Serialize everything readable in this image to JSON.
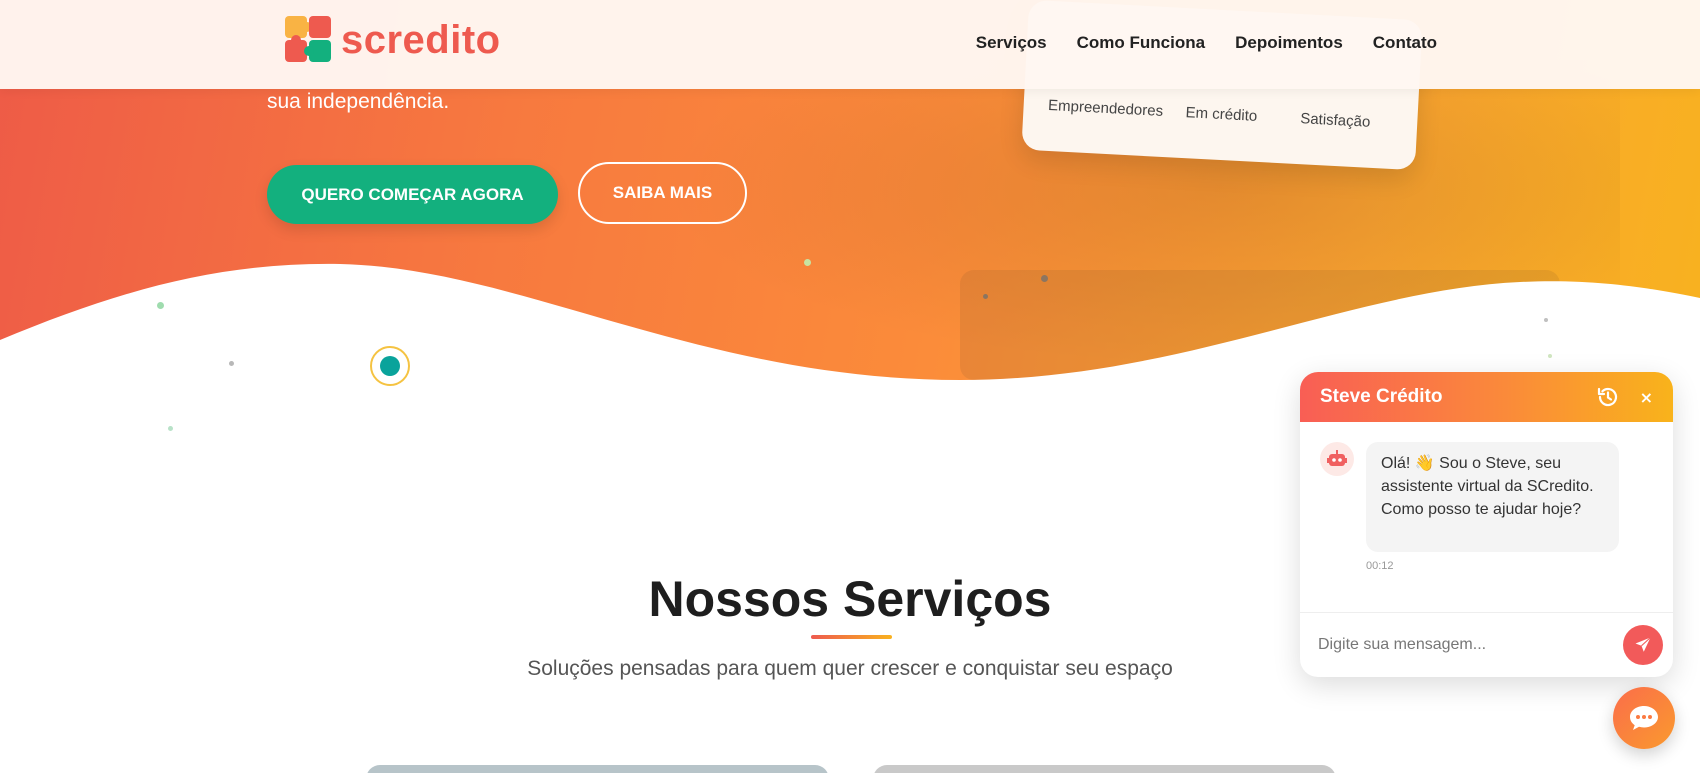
{
  "header": {
    "logo_text": "scredito",
    "nav": [
      "Serviços",
      "Como Funciona",
      "Depoimentos",
      "Contato"
    ]
  },
  "hero": {
    "subtitle_tail": "sua independência.",
    "cta_primary": "QUERO COMEÇAR AGORA",
    "cta_secondary": "SAIBA MAIS",
    "stats": [
      {
        "label": "Empreendedores"
      },
      {
        "label": "Em crédito"
      },
      {
        "label": "Satisfação"
      }
    ]
  },
  "services": {
    "title": "Nossos Serviços",
    "subtitle": "Soluções pensadas para quem quer crescer e conquistar seu espaço"
  },
  "chat": {
    "title": "Steve Crédito",
    "close_label": "×",
    "message": "Olá! 👋 Sou o Steve, seu assistente virtual da SCredito. Como posso te ajudar hoje?",
    "time": "00:12",
    "input_placeholder": "Digite sua mensagem..."
  },
  "colors": {
    "brand_red": "#ee5a4f",
    "brand_green": "#13b07e",
    "brand_orange": "#fa8a3a",
    "brand_yellow": "#f9b21f"
  },
  "icons": [
    "logo-puzzle-icon",
    "history-icon",
    "close-icon",
    "robot-icon",
    "send-icon",
    "chat-bubble-icon"
  ]
}
